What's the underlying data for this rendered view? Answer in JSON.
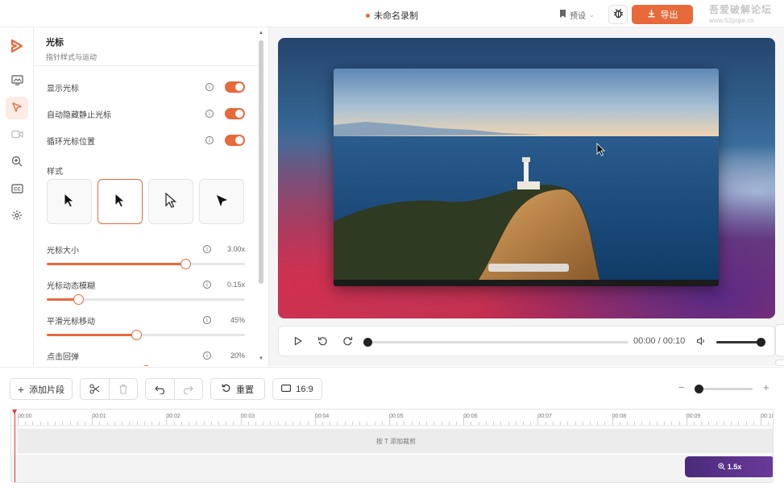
{
  "topbar": {
    "doc_title": "未命名录制",
    "preset_label": "预设",
    "export_label": "导出",
    "watermark_text": "吾爱破解论坛",
    "watermark_url": "www.52pojie.cn"
  },
  "rail": {
    "items": [
      {
        "icon": "logo-icon"
      },
      {
        "icon": "background-image-icon"
      },
      {
        "icon": "cursor-icon",
        "active": true
      },
      {
        "icon": "camera-icon"
      },
      {
        "icon": "zoom-icon"
      },
      {
        "icon": "captions-icon",
        "text": "CC"
      },
      {
        "icon": "settings-icon"
      }
    ]
  },
  "panel": {
    "title": "光标",
    "subtitle": "指针样式与运动",
    "toggles": [
      {
        "label": "显示光标",
        "on": true
      },
      {
        "label": "自动隐藏静止光标",
        "on": true
      },
      {
        "label": "循环光标位置",
        "on": true
      }
    ],
    "style_label": "样式",
    "styles": [
      "macOS",
      "Windows (selected)",
      "Outline",
      "Pointer"
    ],
    "selected_style_index": 1,
    "sliders": [
      {
        "label": "光标大小",
        "value": "3.00x",
        "fraction": 0.7
      },
      {
        "label": "光标动态模糊",
        "value": "0.15x",
        "fraction": 0.16
      },
      {
        "label": "平滑光标移动",
        "value": "45%",
        "fraction": 0.45
      },
      {
        "label": "点击回弹",
        "value": "20%",
        "fraction": 0.5
      }
    ],
    "info_glyph": "i"
  },
  "player": {
    "time": "00:00 / 00:10",
    "progress": 0.0,
    "volume": 1.0
  },
  "toolbar": {
    "add_clip_label": "添加片段",
    "reset_label": "重置",
    "aspect_label": "16:9",
    "zoom_minus": "−",
    "zoom_plus": "+"
  },
  "timeline": {
    "ticks": [
      "00:00",
      "00:01",
      "00:02",
      "00:03",
      "00:04",
      "00:05",
      "00:06",
      "00:07",
      "00:08",
      "00:09",
      "00:10"
    ],
    "main_track_hint": "按 T 添加裁剪",
    "zoom_clip_label": "1.5x"
  },
  "colors": {
    "accent": "#e8693a",
    "zoom_clip": "#5a3088",
    "playhead": "#e23a3a"
  }
}
